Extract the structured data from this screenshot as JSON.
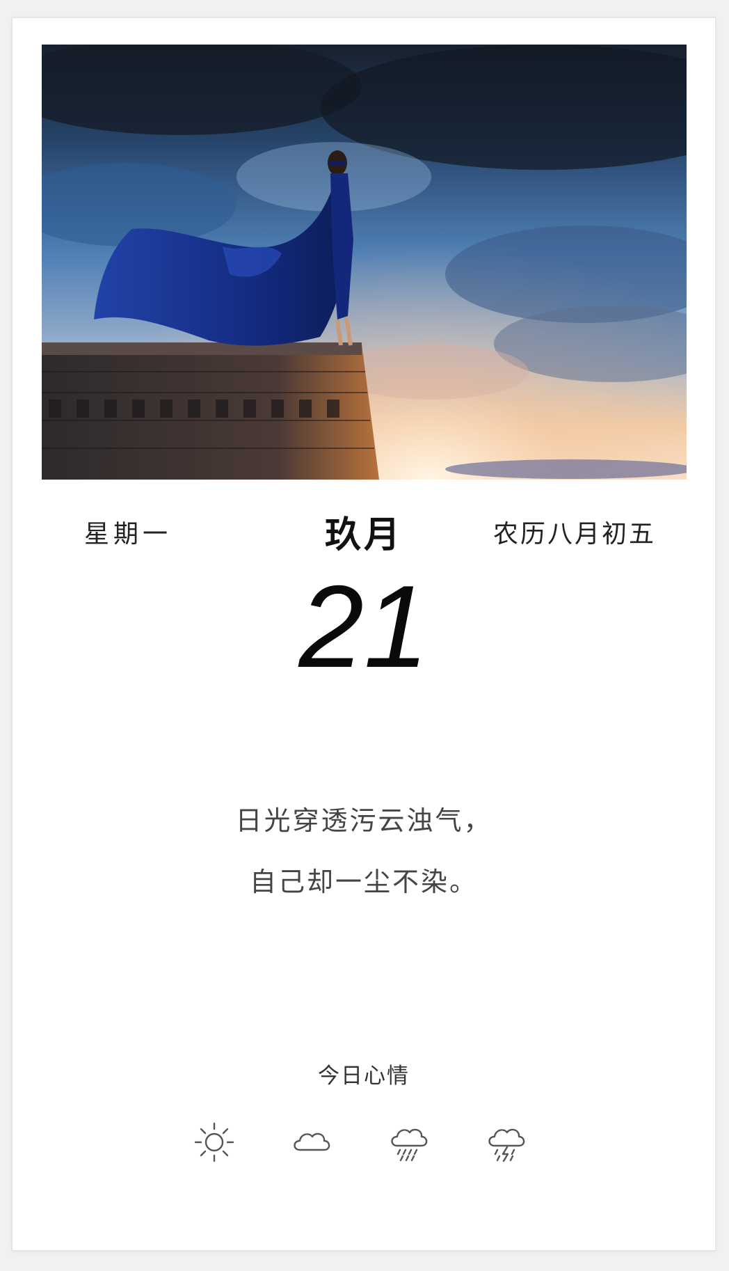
{
  "calendar": {
    "weekday": "星期一",
    "month": "玖月",
    "lunar_date": "农历八月初五",
    "day": "21"
  },
  "quote": {
    "line1": "日光穿透污云浊气，",
    "line2": "自己却一尘不染。"
  },
  "mood": {
    "title": "今日心情",
    "icons": [
      "sun-icon",
      "cloud-icon",
      "rain-icon",
      "thunderstorm-icon"
    ]
  },
  "colors": {
    "cape": "#1e3a9a",
    "sky_dark": "#1b2a3f",
    "sky_light": "#f4c8a6",
    "text_dark": "#111111",
    "icon_stroke": "#555555"
  }
}
